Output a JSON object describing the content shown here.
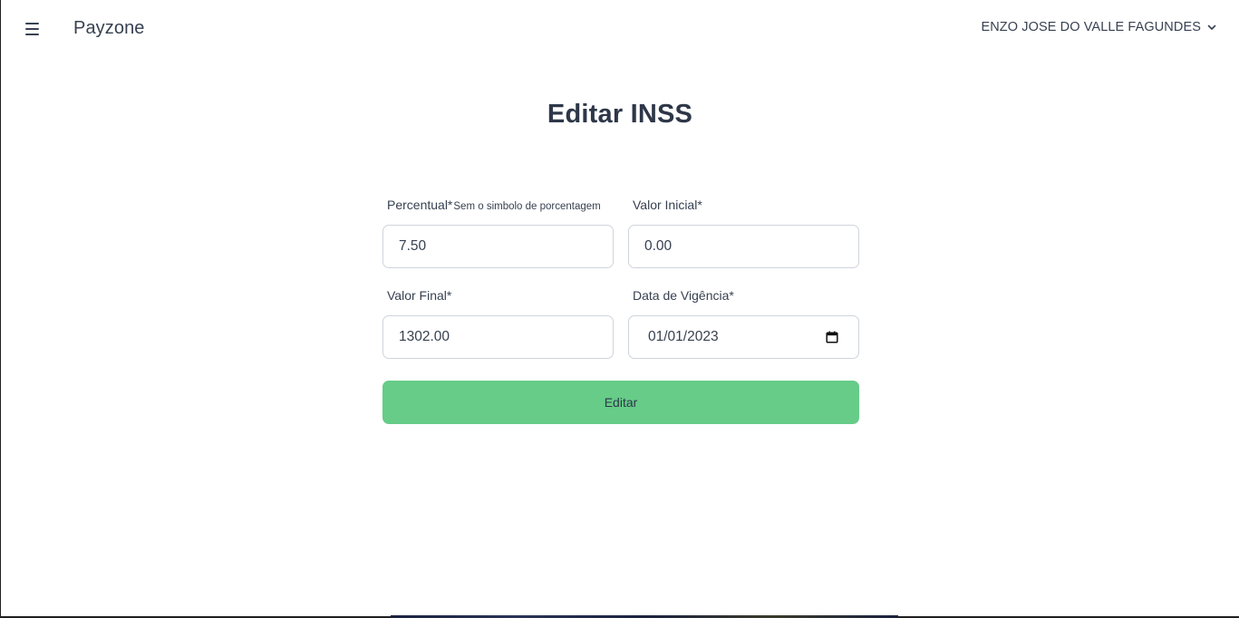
{
  "header": {
    "brand": "Payzone",
    "user_name": "ENZO JOSE DO VALLE FAGUNDES"
  },
  "main": {
    "title": "Editar INSS"
  },
  "form": {
    "percentual": {
      "label": "Percentual*",
      "hint": "Sem o simbolo de porcentagem",
      "value": "7.50"
    },
    "valor_inicial": {
      "label": "Valor Inicial*",
      "value": "0.00"
    },
    "valor_final": {
      "label": "Valor Final*",
      "value": "1302.00"
    },
    "data_vigencia": {
      "label": "Data de Vigência*",
      "value": "01/01/2023"
    },
    "submit_label": "Editar"
  },
  "colors": {
    "accent": "#66cc88",
    "text": "#374151",
    "border": "#cfd4dc"
  },
  "icons": [
    "hamburger-menu-icon",
    "chevron-down-icon",
    "calendar-icon"
  ]
}
